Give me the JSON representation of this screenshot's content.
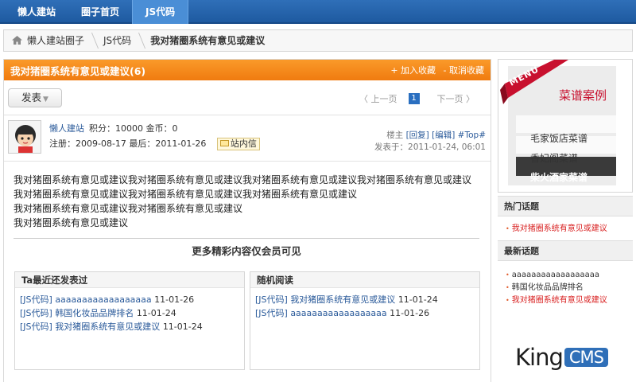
{
  "nav": {
    "tabs": [
      "懒人建站",
      "圈子首页",
      "JS代码"
    ]
  },
  "breadcrumb": {
    "items": [
      "懒人建站圈子",
      "JS代码",
      "我对猪圈系统有意见或建议"
    ]
  },
  "thread": {
    "title": "我对猪圈系统有意见或建议(6)",
    "add_fav": "+ 加入收藏",
    "remove_fav": "- 取消收藏"
  },
  "toolbar": {
    "post_label": "发表",
    "prev": "〈 上一页",
    "page": "1",
    "next": "下一页 〉"
  },
  "author": {
    "name": "懒人建站",
    "stats": "积分：10000  金币：0",
    "meta": "注册：2009-08-17  最后：2011-01-26",
    "pm": "站内信",
    "floor": "楼主",
    "reply": "[回复]",
    "edit": "[编辑]",
    "top": "#Top#",
    "posted": "发表于：2011-01-24, 06:01"
  },
  "post": {
    "lines": [
      "我对猪圈系统有意见或建议我对猪圈系统有意见或建议我对猪圈系统有意见或建议我对猪圈系统有意见或建议",
      "我对猪圈系统有意见或建议我对猪圈系统有意见或建议我对猪圈系统有意见或建议",
      "我对猪圈系统有意见或建议我对猪圈系统有意见或建议",
      "我对猪圈系统有意见或建议"
    ],
    "more": "更多精彩内容仅会员可见"
  },
  "recent": {
    "title": "Ta最近还发表过",
    "items": [
      {
        "tag": "[JS代码]",
        "text": "aaaaaaaaaaaaaaaaaa",
        "date": "11-01-26"
      },
      {
        "tag": "[JS代码]",
        "text": "韩国化妆品品牌排名",
        "date": "11-01-24"
      },
      {
        "tag": "[JS代码]",
        "text": "我对猪圈系统有意见或建议",
        "date": "11-01-24"
      }
    ]
  },
  "random": {
    "title": "随机阅读",
    "items": [
      {
        "tag": "[JS代码]",
        "text": "我对猪圈系统有意见或建议",
        "date": "11-01-24"
      },
      {
        "tag": "[JS代码]",
        "text": "aaaaaaaaaaaaaaaaaa",
        "date": "11-01-26"
      }
    ]
  },
  "sidebar": {
    "menu_ribbon": "MENU",
    "menu_title": "菜谱案例",
    "menu_items": [
      "毛家饭店菜谱",
      "香妃阁菜谱",
      "柴火酒家菜谱"
    ],
    "hot_title": "热门话题",
    "hot_items": [
      "我对猪圈系统有意见或建议"
    ],
    "new_title": "最新话题",
    "new_items": [
      "aaaaaaaaaaaaaaaaaa",
      "韩国化妆品品牌排名",
      "我对猪圈系统有意见或建议"
    ]
  },
  "logo": {
    "king": "King",
    "cms": "CMS"
  },
  "colors": {
    "nav_blue": "#1e5aa0",
    "title_orange": "#f07b10",
    "link_blue": "#2a5a9a",
    "hot_red": "#d81e1e"
  }
}
